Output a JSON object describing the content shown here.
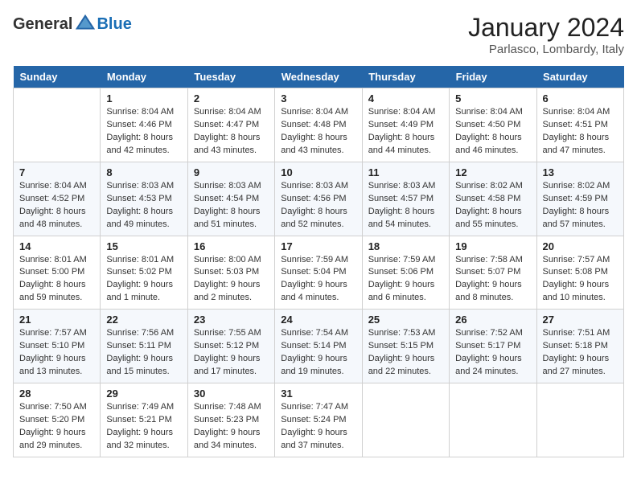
{
  "logo": {
    "text_general": "General",
    "text_blue": "Blue"
  },
  "title": "January 2024",
  "subtitle": "Parlasco, Lombardy, Italy",
  "weekdays": [
    "Sunday",
    "Monday",
    "Tuesday",
    "Wednesday",
    "Thursday",
    "Friday",
    "Saturday"
  ],
  "weeks": [
    [
      {
        "day": "",
        "detail": ""
      },
      {
        "day": "1",
        "detail": "Sunrise: 8:04 AM\nSunset: 4:46 PM\nDaylight: 8 hours\nand 42 minutes."
      },
      {
        "day": "2",
        "detail": "Sunrise: 8:04 AM\nSunset: 4:47 PM\nDaylight: 8 hours\nand 43 minutes."
      },
      {
        "day": "3",
        "detail": "Sunrise: 8:04 AM\nSunset: 4:48 PM\nDaylight: 8 hours\nand 43 minutes."
      },
      {
        "day": "4",
        "detail": "Sunrise: 8:04 AM\nSunset: 4:49 PM\nDaylight: 8 hours\nand 44 minutes."
      },
      {
        "day": "5",
        "detail": "Sunrise: 8:04 AM\nSunset: 4:50 PM\nDaylight: 8 hours\nand 46 minutes."
      },
      {
        "day": "6",
        "detail": "Sunrise: 8:04 AM\nSunset: 4:51 PM\nDaylight: 8 hours\nand 47 minutes."
      }
    ],
    [
      {
        "day": "7",
        "detail": "Sunrise: 8:04 AM\nSunset: 4:52 PM\nDaylight: 8 hours\nand 48 minutes."
      },
      {
        "day": "8",
        "detail": "Sunrise: 8:03 AM\nSunset: 4:53 PM\nDaylight: 8 hours\nand 49 minutes."
      },
      {
        "day": "9",
        "detail": "Sunrise: 8:03 AM\nSunset: 4:54 PM\nDaylight: 8 hours\nand 51 minutes."
      },
      {
        "day": "10",
        "detail": "Sunrise: 8:03 AM\nSunset: 4:56 PM\nDaylight: 8 hours\nand 52 minutes."
      },
      {
        "day": "11",
        "detail": "Sunrise: 8:03 AM\nSunset: 4:57 PM\nDaylight: 8 hours\nand 54 minutes."
      },
      {
        "day": "12",
        "detail": "Sunrise: 8:02 AM\nSunset: 4:58 PM\nDaylight: 8 hours\nand 55 minutes."
      },
      {
        "day": "13",
        "detail": "Sunrise: 8:02 AM\nSunset: 4:59 PM\nDaylight: 8 hours\nand 57 minutes."
      }
    ],
    [
      {
        "day": "14",
        "detail": "Sunrise: 8:01 AM\nSunset: 5:00 PM\nDaylight: 8 hours\nand 59 minutes."
      },
      {
        "day": "15",
        "detail": "Sunrise: 8:01 AM\nSunset: 5:02 PM\nDaylight: 9 hours\nand 1 minute."
      },
      {
        "day": "16",
        "detail": "Sunrise: 8:00 AM\nSunset: 5:03 PM\nDaylight: 9 hours\nand 2 minutes."
      },
      {
        "day": "17",
        "detail": "Sunrise: 7:59 AM\nSunset: 5:04 PM\nDaylight: 9 hours\nand 4 minutes."
      },
      {
        "day": "18",
        "detail": "Sunrise: 7:59 AM\nSunset: 5:06 PM\nDaylight: 9 hours\nand 6 minutes."
      },
      {
        "day": "19",
        "detail": "Sunrise: 7:58 AM\nSunset: 5:07 PM\nDaylight: 9 hours\nand 8 minutes."
      },
      {
        "day": "20",
        "detail": "Sunrise: 7:57 AM\nSunset: 5:08 PM\nDaylight: 9 hours\nand 10 minutes."
      }
    ],
    [
      {
        "day": "21",
        "detail": "Sunrise: 7:57 AM\nSunset: 5:10 PM\nDaylight: 9 hours\nand 13 minutes."
      },
      {
        "day": "22",
        "detail": "Sunrise: 7:56 AM\nSunset: 5:11 PM\nDaylight: 9 hours\nand 15 minutes."
      },
      {
        "day": "23",
        "detail": "Sunrise: 7:55 AM\nSunset: 5:12 PM\nDaylight: 9 hours\nand 17 minutes."
      },
      {
        "day": "24",
        "detail": "Sunrise: 7:54 AM\nSunset: 5:14 PM\nDaylight: 9 hours\nand 19 minutes."
      },
      {
        "day": "25",
        "detail": "Sunrise: 7:53 AM\nSunset: 5:15 PM\nDaylight: 9 hours\nand 22 minutes."
      },
      {
        "day": "26",
        "detail": "Sunrise: 7:52 AM\nSunset: 5:17 PM\nDaylight: 9 hours\nand 24 minutes."
      },
      {
        "day": "27",
        "detail": "Sunrise: 7:51 AM\nSunset: 5:18 PM\nDaylight: 9 hours\nand 27 minutes."
      }
    ],
    [
      {
        "day": "28",
        "detail": "Sunrise: 7:50 AM\nSunset: 5:20 PM\nDaylight: 9 hours\nand 29 minutes."
      },
      {
        "day": "29",
        "detail": "Sunrise: 7:49 AM\nSunset: 5:21 PM\nDaylight: 9 hours\nand 32 minutes."
      },
      {
        "day": "30",
        "detail": "Sunrise: 7:48 AM\nSunset: 5:23 PM\nDaylight: 9 hours\nand 34 minutes."
      },
      {
        "day": "31",
        "detail": "Sunrise: 7:47 AM\nSunset: 5:24 PM\nDaylight: 9 hours\nand 37 minutes."
      },
      {
        "day": "",
        "detail": ""
      },
      {
        "day": "",
        "detail": ""
      },
      {
        "day": "",
        "detail": ""
      }
    ]
  ]
}
